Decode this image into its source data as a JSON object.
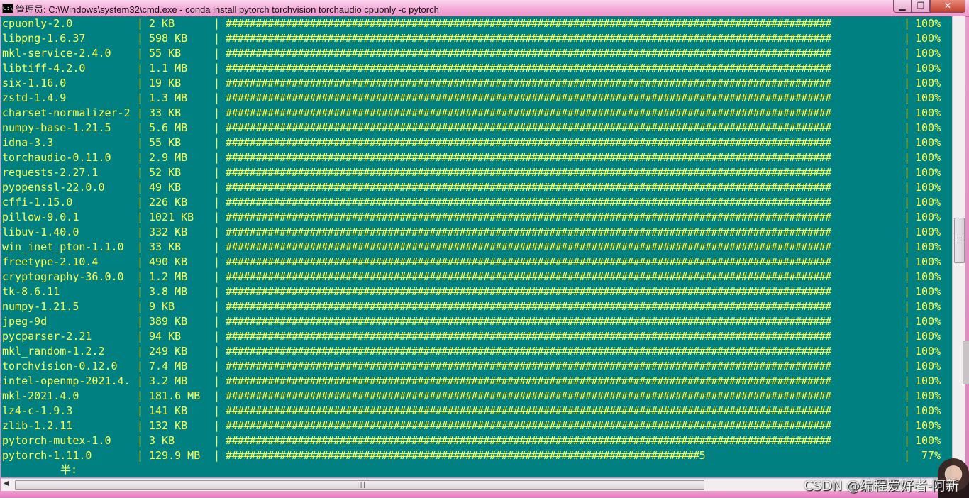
{
  "window": {
    "title": "管理员: C:\\Windows\\system32\\cmd.exe - conda  install pytorch torchvision torchaudio cpuonly -c pytorch",
    "icon_name": "cmd-icon",
    "buttons": {
      "minimize": "▁",
      "maximize": "❐",
      "close": "✕"
    }
  },
  "colors": {
    "console_bg": "#008080",
    "console_text": "#ffff55",
    "titlebar": "#f3a9d7"
  },
  "separator": "|",
  "packages": [
    {
      "name": "cpuonly-2.0",
      "size": "2 KB",
      "bar": "#####################################################################################################",
      "pct": "100%"
    },
    {
      "name": "libpng-1.6.37",
      "size": "598 KB",
      "bar": "#####################################################################################################",
      "pct": "100%"
    },
    {
      "name": "mkl-service-2.4.0",
      "size": "55 KB",
      "bar": "#####################################################################################################",
      "pct": "100%"
    },
    {
      "name": "libtiff-4.2.0",
      "size": "1.1 MB",
      "bar": "#####################################################################################################",
      "pct": "100%"
    },
    {
      "name": "six-1.16.0",
      "size": "19 KB",
      "bar": "#####################################################################################################",
      "pct": "100%"
    },
    {
      "name": "zstd-1.4.9",
      "size": "1.3 MB",
      "bar": "#####################################################################################################",
      "pct": "100%"
    },
    {
      "name": "charset-normalizer-2",
      "size": "33 KB",
      "bar": "#####################################################################################################",
      "pct": "100%"
    },
    {
      "name": "numpy-base-1.21.5",
      "size": "5.6 MB",
      "bar": "#####################################################################################################",
      "pct": "100%"
    },
    {
      "name": "idna-3.3",
      "size": "55 KB",
      "bar": "#####################################################################################################",
      "pct": "100%"
    },
    {
      "name": "torchaudio-0.11.0",
      "size": "2.9 MB",
      "bar": "#####################################################################################################",
      "pct": "100%"
    },
    {
      "name": "requests-2.27.1",
      "size": "52 KB",
      "bar": "#####################################################################################################",
      "pct": "100%"
    },
    {
      "name": "pyopenssl-22.0.0",
      "size": "49 KB",
      "bar": "#####################################################################################################",
      "pct": "100%"
    },
    {
      "name": "cffi-1.15.0",
      "size": "226 KB",
      "bar": "#####################################################################################################",
      "pct": "100%"
    },
    {
      "name": "pillow-9.0.1",
      "size": "1021 KB",
      "bar": "#####################################################################################################",
      "pct": "100%"
    },
    {
      "name": "libuv-1.40.0",
      "size": "332 KB",
      "bar": "#####################################################################################################",
      "pct": "100%"
    },
    {
      "name": "win_inet_pton-1.1.0",
      "size": "33 KB",
      "bar": "#####################################################################################################",
      "pct": "100%"
    },
    {
      "name": "freetype-2.10.4",
      "size": "490 KB",
      "bar": "#####################################################################################################",
      "pct": "100%"
    },
    {
      "name": "cryptography-36.0.0",
      "size": "1.2 MB",
      "bar": "#####################################################################################################",
      "pct": "100%"
    },
    {
      "name": "tk-8.6.11",
      "size": "3.8 MB",
      "bar": "#####################################################################################################",
      "pct": "100%"
    },
    {
      "name": "numpy-1.21.5",
      "size": "9 KB",
      "bar": "#####################################################################################################",
      "pct": "100%"
    },
    {
      "name": "jpeg-9d",
      "size": "389 KB",
      "bar": "#####################################################################################################",
      "pct": "100%"
    },
    {
      "name": "pycparser-2.21",
      "size": "94 KB",
      "bar": "#####################################################################################################",
      "pct": "100%"
    },
    {
      "name": "mkl_random-1.2.2",
      "size": "249 KB",
      "bar": "#####################################################################################################",
      "pct": "100%"
    },
    {
      "name": "torchvision-0.12.0",
      "size": "7.4 MB",
      "bar": "#####################################################################################################",
      "pct": "100%"
    },
    {
      "name": "intel-openmp-2021.4.",
      "size": "3.2 MB",
      "bar": "#####################################################################################################",
      "pct": "100%"
    },
    {
      "name": "mkl-2021.4.0",
      "size": "181.6 MB",
      "bar": "#####################################################################################################",
      "pct": "100%"
    },
    {
      "name": "lz4-c-1.9.3",
      "size": "141 KB",
      "bar": "#####################################################################################################",
      "pct": "100%"
    },
    {
      "name": "zlib-1.2.11",
      "size": "132 KB",
      "bar": "#####################################################################################################",
      "pct": "100%"
    },
    {
      "name": "pytorch-mutex-1.0",
      "size": "3 KB",
      "bar": "#####################################################################################################",
      "pct": "100%"
    },
    {
      "name": "pytorch-1.11.0",
      "size": "129.9 MB",
      "bar": "###############################################################################5",
      "pct": "77%"
    }
  ],
  "prompt_line": "半:",
  "scrollbar": {
    "h_grip": "|||"
  },
  "watermark": "CSDN @编程爱好者-阿新"
}
